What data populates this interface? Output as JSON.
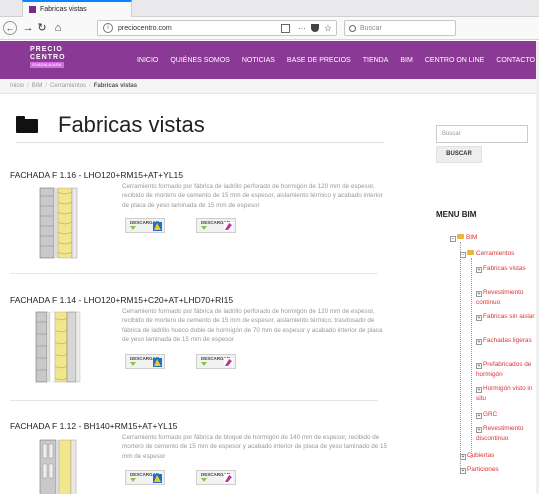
{
  "browser": {
    "tab_title": "Fabricas vistas",
    "url": "preciocentro.com",
    "search_placeholder": "Buscar"
  },
  "site": {
    "logo_line1": "PRECIO",
    "logo_line2": "CENTRO",
    "logo_line3": "GUADALAJARA",
    "nav": [
      "INICIO",
      "QUIÉNES SOMOS",
      "NOTICIAS",
      "BASE DE PRECIOS",
      "TIENDA",
      "BIM",
      "CENTRO ON LINE",
      "CONTACTO"
    ]
  },
  "breadcrumb": [
    "Inicio",
    "BIM",
    "Cerramientos",
    "Fabricas vistas"
  ],
  "page_title": "Fabricas vistas",
  "download_label": "DESCARGAR",
  "items": [
    {
      "title": "FACHADA F 1.16 - LHO120+RM15+AT+YL15",
      "description": "Cerramiento formado por fábrica de ladrillo perforado de hormigón de 120 mm de espesor, recibido de mortero de cemento de 15 mm de espesor, aislamiento térmico y acabado interior de placa de yeso laminada de 15 mm de espesor"
    },
    {
      "title": "FACHADA F 1.14 - LHO120+RM15+C20+AT+LHD70+RI15",
      "description": "Cerramiento formado por fábrica de ladrillo perforado de hormigón de 120 mm de espesor, recibido de mortero de cemento de 15 mm de espesor, aislamiento térmico, trasdosado de fábrica de ladrillo hueco doble de hormigón de 70 mm de espesor y acabado interior de placa de yeso laminada de 15 mm de espesor"
    },
    {
      "title": "FACHADA F 1.12 - BH140+RM15+AT+YL15",
      "description": "Cerramiento formado por fábrica de bloque de hormigón de 140 mm de espesor, recibido de mortero de cemento de 15 mm de espesor y acabado interior de placa de yeso laminado de 15 mm de espesor"
    }
  ],
  "sidebar": {
    "search_placeholder": "Buscar",
    "search_button": "BUSCAR",
    "menu_title": "MENU BIM",
    "tree": {
      "root": "BIM",
      "cerramientos": "Cerramientos",
      "fabricas_vistas": "Fabricas vistas",
      "revestimiento_continuo": "Revestimiento continuo",
      "fabricas_sin_aislar": "Fabricas sin aislar",
      "fachadas_ligeras": "Fachadas ligeras",
      "prefabricados": "Prefabricados de hormigón",
      "hormigon_visto": "Hormigón visto in situ",
      "grc": "GRC",
      "revestimiento_discontinuo": "Revestimiento discontinuo",
      "cubiertas": "Cubiertas",
      "particiones": "Particiones"
    }
  }
}
